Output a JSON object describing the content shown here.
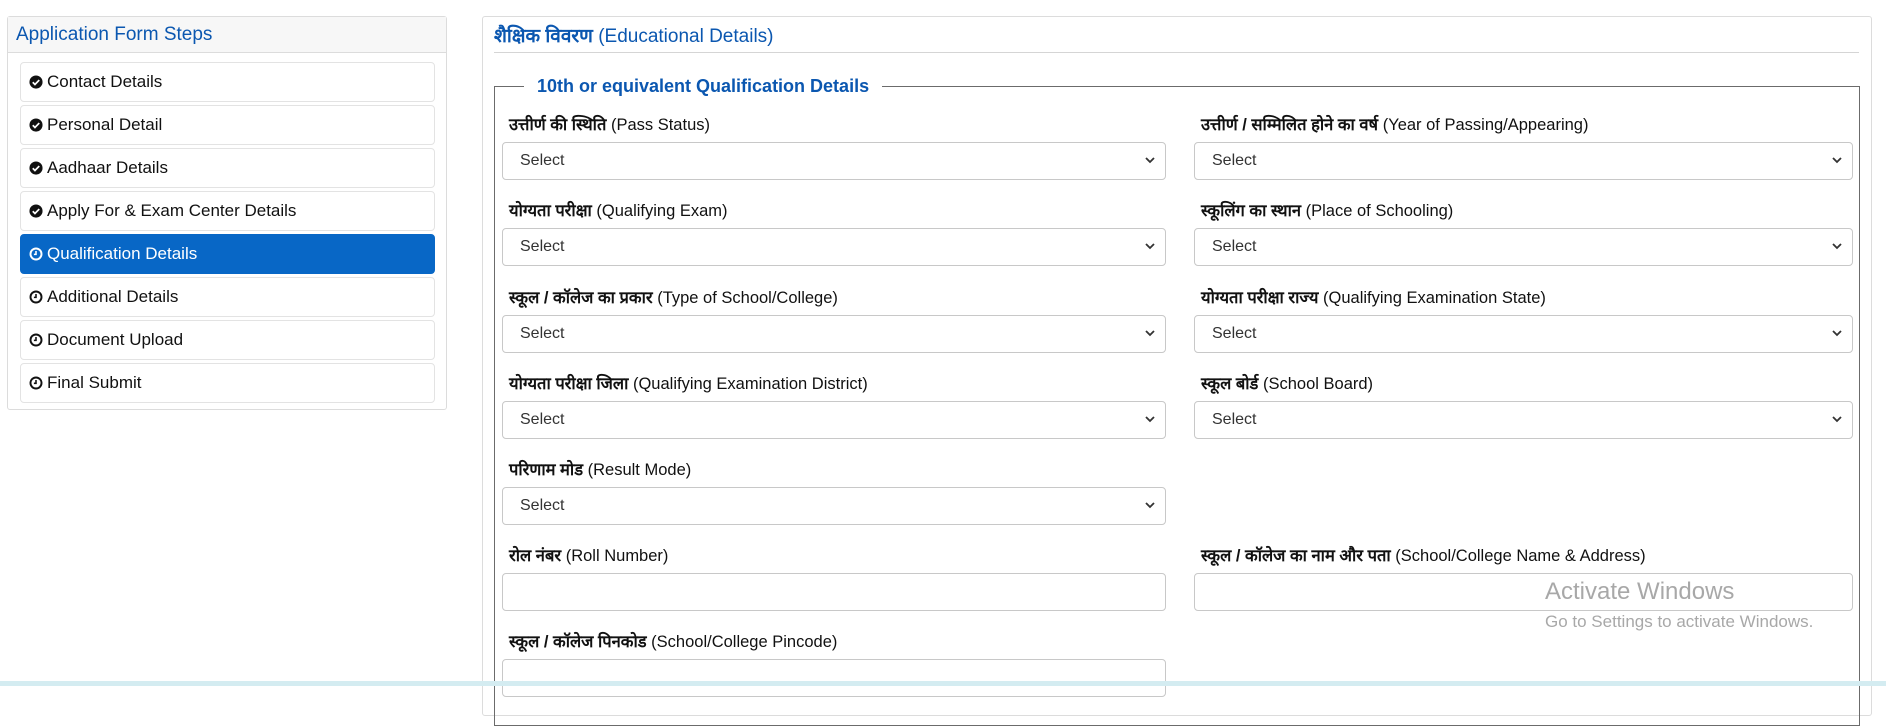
{
  "sidebar": {
    "title": "Application Form Steps",
    "items": [
      {
        "label": "Contact Details",
        "status": "completed",
        "icon": "check-circle-icon"
      },
      {
        "label": "Personal Detail",
        "status": "completed",
        "icon": "check-circle-icon"
      },
      {
        "label": "Aadhaar Details",
        "status": "completed",
        "icon": "check-circle-icon"
      },
      {
        "label": "Apply For & Exam Center Details",
        "status": "completed",
        "icon": "check-circle-icon"
      },
      {
        "label": "Qualification Details",
        "status": "active",
        "icon": "clock-icon"
      },
      {
        "label": "Additional Details",
        "status": "pending",
        "icon": "clock-icon"
      },
      {
        "label": "Document Upload",
        "status": "pending",
        "icon": "clock-icon"
      },
      {
        "label": "Final Submit",
        "status": "pending",
        "icon": "clock-icon"
      }
    ]
  },
  "main": {
    "title_hi": "शैक्षिक विवरण",
    "title_en": "(Educational Details)",
    "section_legend": "10th or equivalent Qualification Details",
    "fields": {
      "pass_status": {
        "label_hi": "उत्तीर्ण की स्थिति",
        "label_en": "(Pass Status)",
        "value": "Select"
      },
      "year_of_passing": {
        "label_hi": "उत्तीर्ण / सम्मिलित होने का वर्ष",
        "label_en": "(Year of Passing/Appearing)",
        "value": "Select"
      },
      "qualifying_exam": {
        "label_hi": "योग्यता परीक्षा",
        "label_en": "(Qualifying Exam)",
        "value": "Select"
      },
      "place_of_schooling": {
        "label_hi": "स्कूलिंग का स्थान",
        "label_en": "(Place of Schooling)",
        "value": "Select"
      },
      "type_of_school": {
        "label_hi": "स्कूल / कॉलेज का प्रकार",
        "label_en": "(Type of School/College)",
        "value": "Select"
      },
      "exam_state": {
        "label_hi": "योग्यता परीक्षा राज्य",
        "label_en": "(Qualifying Examination State)",
        "value": "Select"
      },
      "exam_district": {
        "label_hi": "योग्यता परीक्षा जिला",
        "label_en": "(Qualifying Examination District)",
        "value": "Select"
      },
      "school_board": {
        "label_hi": "स्कूल बोर्ड",
        "label_en": "(School Board)",
        "value": "Select"
      },
      "result_mode": {
        "label_hi": "परिणाम मोड",
        "label_en": "(Result Mode)",
        "value": "Select"
      },
      "roll_number": {
        "label_hi": "रोल नंबर",
        "label_en": "(Roll Number)",
        "value": ""
      },
      "school_name_address": {
        "label_hi": "स्कूल / कॉलेज का नाम और पता",
        "label_en": "(School/College Name & Address)",
        "value": ""
      },
      "school_pincode": {
        "label_hi": "स्कूल / कॉलेज पिनकोड",
        "label_en": "(School/College Pincode)",
        "value": ""
      }
    }
  },
  "watermark": {
    "line1": "Activate Windows",
    "line2": "Go to Settings to activate Windows."
  },
  "colors": {
    "accent": "#0b57b0",
    "active_step": "#0867c6"
  }
}
